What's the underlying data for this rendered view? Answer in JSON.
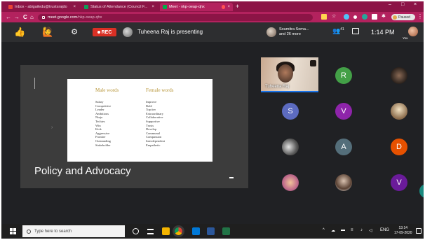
{
  "browser": {
    "tabs": [
      {
        "title": "Inbox - abigailedu@trustsrajdo",
        "close": "×"
      },
      {
        "title": "Status of Attendance (Council F...",
        "close": "×"
      },
      {
        "title": "Meet - nkp-oeap-qhx",
        "close": "×"
      }
    ],
    "new_tab": "+",
    "window_controls": [
      "–",
      "□",
      "×"
    ],
    "nav": {
      "back": "←",
      "forward": "→",
      "reload": "C",
      "home": "⌂"
    },
    "url_host": "meet.google.com",
    "url_path": "/nkp-oeap-qhx",
    "profile_status": "Paused",
    "menu": "⋮"
  },
  "meet_bar": {
    "rec_label": "REC",
    "presenting_text": "Tuheena Raj is presenting",
    "participants_text_line1": "Soumitra Soma...",
    "participants_text_line2": "and 26 more",
    "participant_count": "41",
    "time": "1:14 PM",
    "you_label": "You"
  },
  "slide": {
    "left_heading": "Male words",
    "right_heading": "Female words",
    "male_words": [
      "Salary",
      "Competitive",
      "Leader",
      "Ambitious",
      "Ninja",
      "Techies",
      "Win",
      "Kick",
      "Aggressive",
      "Frontier",
      "Outstanding",
      "Stakeholder"
    ],
    "female_words": [
      "Improve",
      "Bold",
      "Top tier",
      "Extraordinary",
      "Collaborative",
      "Supportive",
      "Trusts",
      "Develop",
      "Communal",
      "Compassion",
      "Interdependent",
      "Empathetic"
    ],
    "title": "Policy and Advocacy"
  },
  "tiles": {
    "self_label": "Tuheena Raj",
    "letters": [
      "R",
      "S",
      "V",
      "A",
      "D",
      "V"
    ],
    "colors": {
      "r": "#43a047",
      "s": "#5c6bc0",
      "v": "#8e24aa",
      "a": "#546e7a",
      "d": "#e65100",
      "v2": "#6a1b9a"
    }
  },
  "taskbar": {
    "search_placeholder": "Type here to search",
    "lang": "ENG",
    "time": "13:14",
    "date": "17-09-2020"
  }
}
